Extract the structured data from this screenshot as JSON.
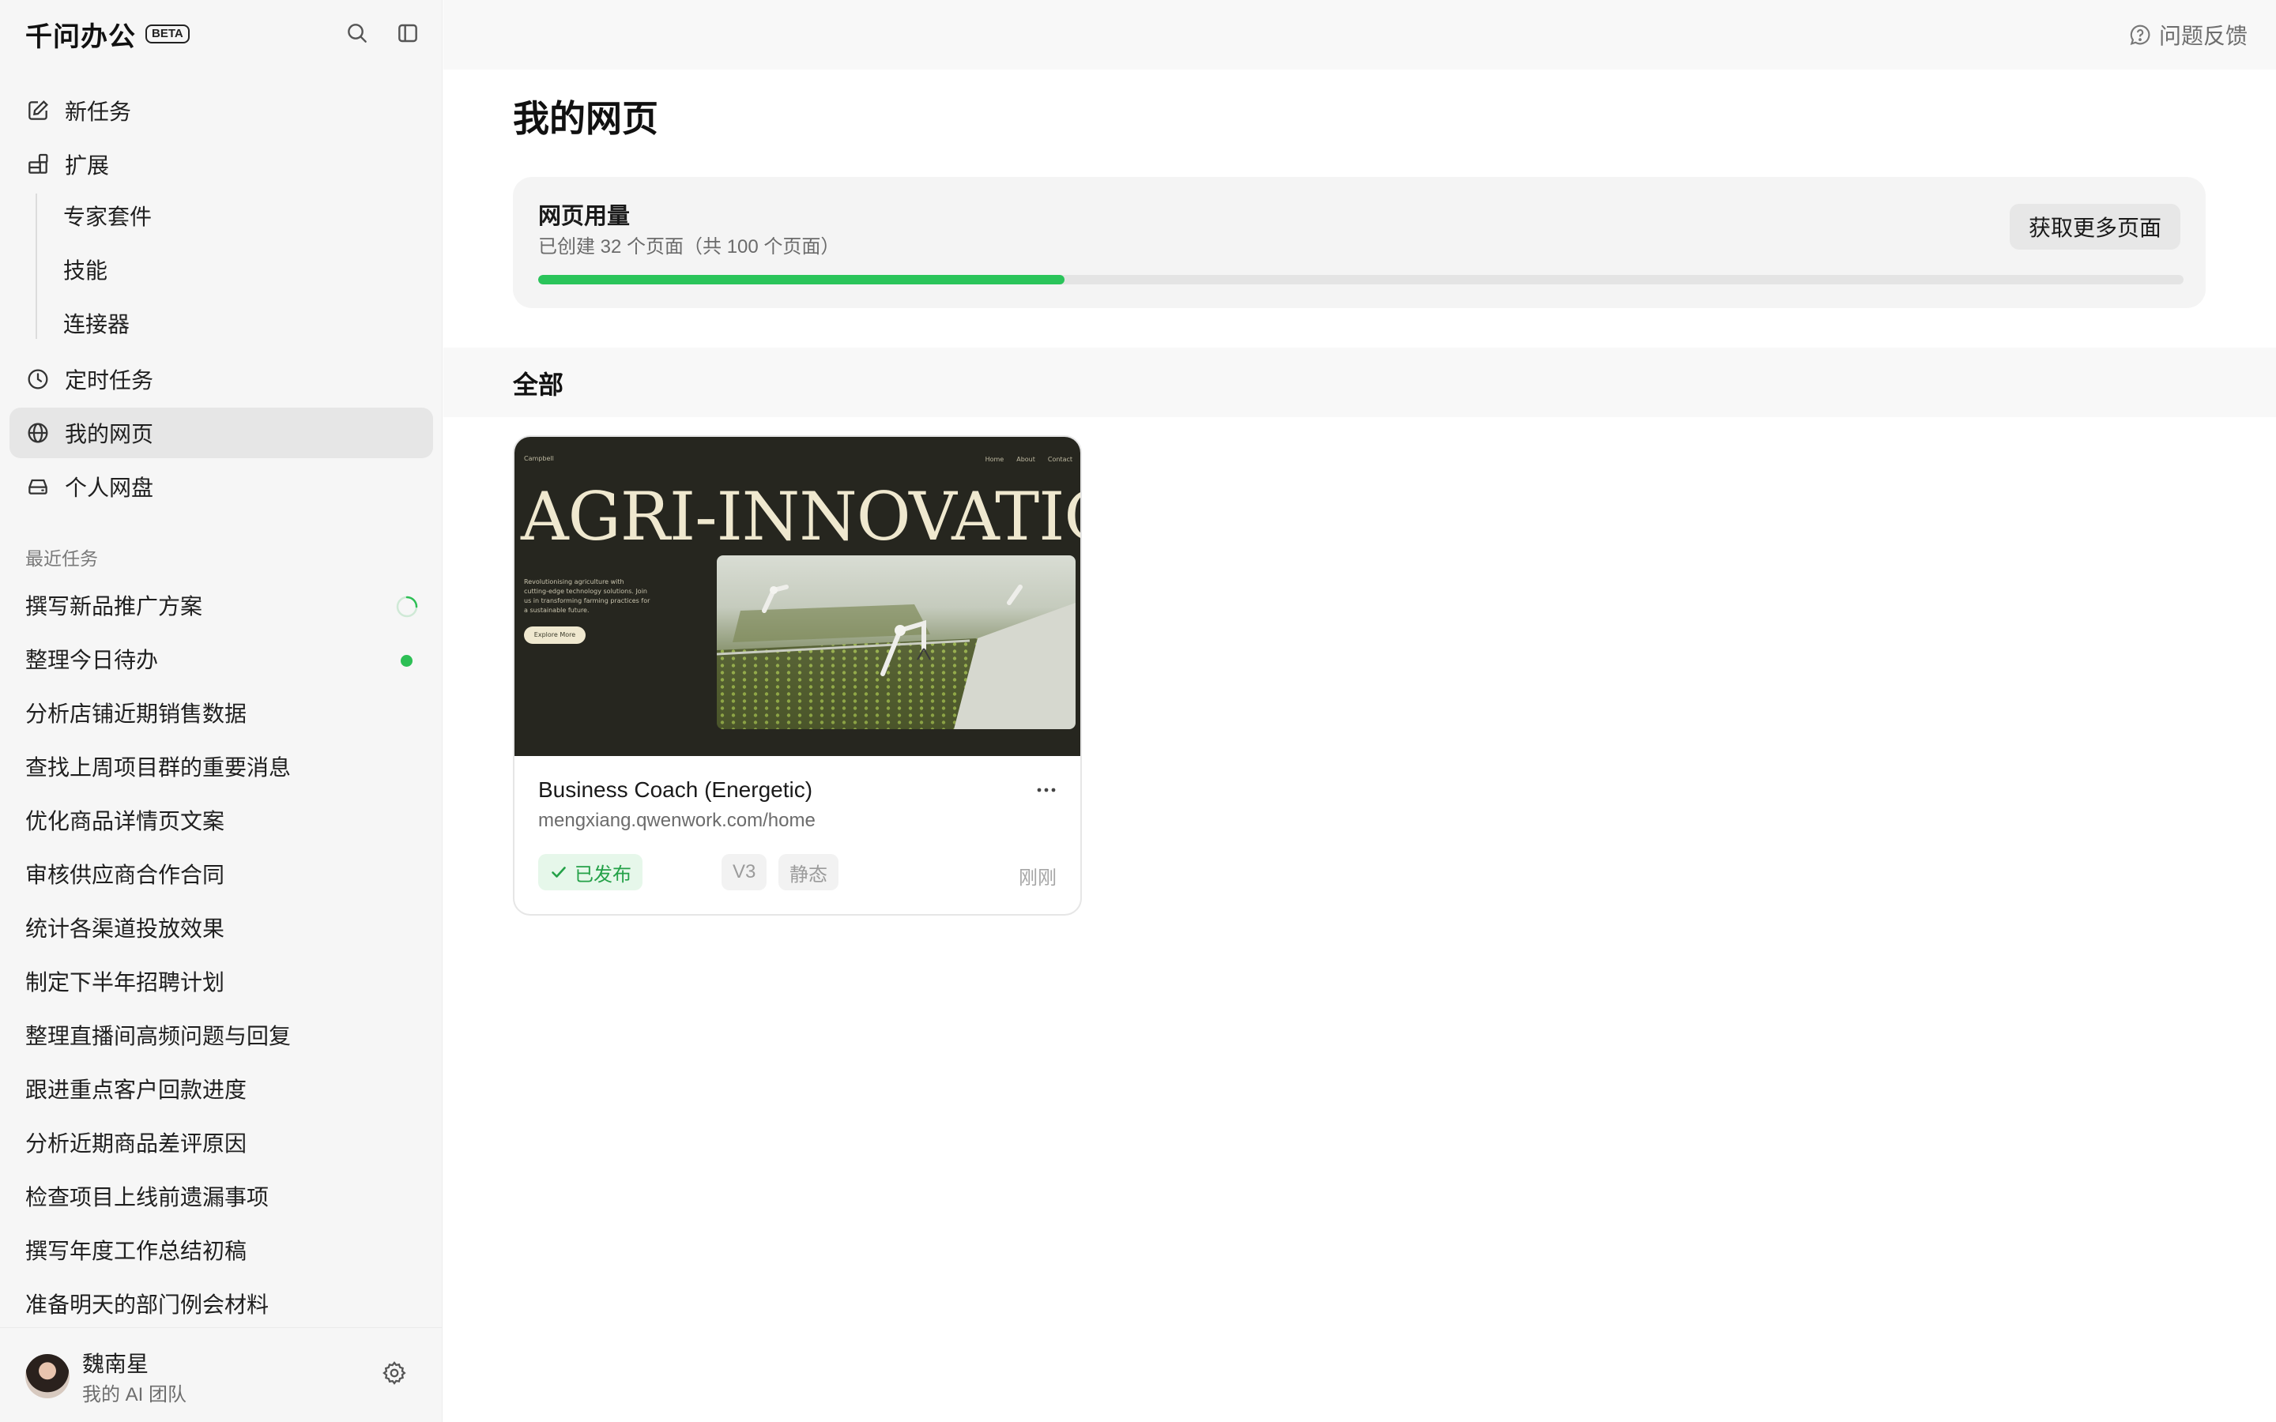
{
  "app": {
    "name": "千问办公",
    "badge": "BETA"
  },
  "sidebar": {
    "nav": [
      {
        "label": "新任务",
        "icon": "edit-icon"
      },
      {
        "label": "扩展",
        "icon": "extensions-icon"
      },
      {
        "label": "定时任务",
        "icon": "clock-icon"
      },
      {
        "label": "我的网页",
        "icon": "globe-icon"
      },
      {
        "label": "个人网盘",
        "icon": "drive-icon"
      }
    ],
    "sub_items": [
      "专家套件",
      "技能",
      "连接器"
    ],
    "recent_label": "最近任务",
    "recent": [
      "撰写新品推广方案",
      "整理今日待办",
      "分析店铺近期销售数据",
      "查找上周项目群的重要消息",
      "优化商品详情页文案",
      "审核供应商合作合同",
      "统计各渠道投放效果",
      "制定下半年招聘计划",
      "整理直播间高频问题与回复",
      "跟进重点客户回款进度",
      "分析近期商品差评原因",
      "检查项目上线前遗漏事项",
      "撰写年度工作总结初稿",
      "准备明天的部门例会材料"
    ],
    "user": {
      "name": "魏南星",
      "team": "我的 AI 团队"
    }
  },
  "topbar": {
    "feedback_label": "问题反馈"
  },
  "main": {
    "title": "我的网页",
    "usage": {
      "title": "网页用量",
      "subtitle": "已创建 32 个页面（共 100 个页面）",
      "button": "获取更多页面",
      "used": 32,
      "total": 100
    },
    "section_title": "全部",
    "cards": [
      {
        "name": "Business Coach (Energetic)",
        "url": "mengxiang.qwenwork.com/home",
        "status": "已发布",
        "version": "V3",
        "type": "静态",
        "time": "刚刚",
        "preview": {
          "logo": "Campbell",
          "nav": [
            "Home",
            "About",
            "Contact"
          ],
          "hero": "AGRI-INNOVATION",
          "description": "Revolutionising agriculture with cutting-edge technology solutions. Join us in transforming farming practices for a sustainable future.",
          "cta": "Explore More"
        }
      }
    ]
  },
  "colors": {
    "accent_green": "#2ac45a",
    "published_text": "#24a148",
    "published_bg": "#e6f7ea"
  }
}
